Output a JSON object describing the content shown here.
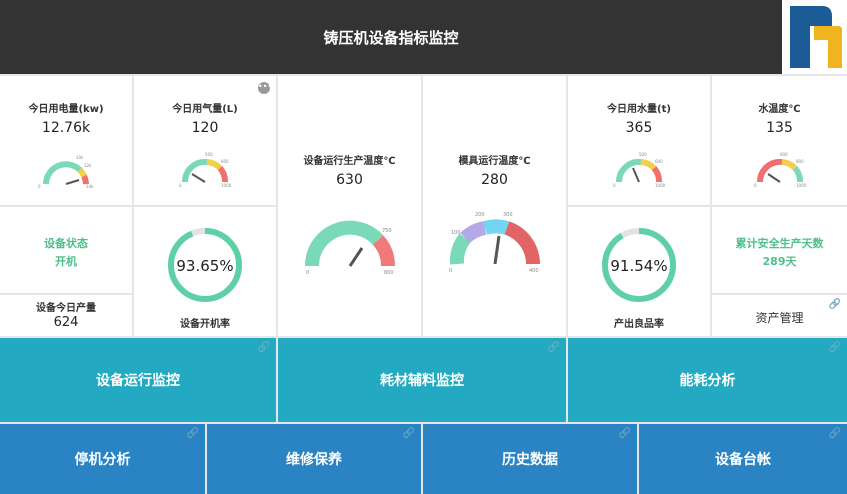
{
  "header": {
    "title": "铸压机设备指标监控"
  },
  "icons": {
    "link": "link-icon",
    "more": "more-icon",
    "logo": "company-logo"
  },
  "colors": {
    "teal": "#23aac2",
    "blue": "#2a84c3",
    "green": "#4fbf8c",
    "header": "#333333"
  },
  "cards": {
    "electricity": {
      "label": "今日用电量(kw)",
      "value": "12.76k",
      "ticks": [
        "0",
        "10k",
        "12k",
        "14k"
      ]
    },
    "gas": {
      "label": "今日用气量(L)",
      "value": "120",
      "ticks": [
        "0",
        "500",
        "600",
        "1000"
      ]
    },
    "device_temp": {
      "label": "设备运行生产温度℃",
      "value": "630",
      "ticks": [
        "0",
        "750",
        "800"
      ]
    },
    "mold_temp": {
      "label": "模具运行温度℃",
      "value": "280",
      "ticks": [
        "0",
        "100",
        "200",
        "300",
        "400"
      ]
    },
    "water": {
      "label": "今日用水量(t)",
      "value": "365",
      "ticks": [
        "0",
        "500",
        "600",
        "1000"
      ]
    },
    "water_temp": {
      "label": "水温度℃",
      "value": "135",
      "ticks": [
        "0",
        "600",
        "800",
        "1000"
      ]
    },
    "device_status": {
      "label": "设备状态",
      "value": "开机"
    },
    "daily_output": {
      "label": "设备今日产量",
      "value": "624"
    },
    "uptime": {
      "label": "设备开机率",
      "value": "93.65%",
      "fraction": 0.9365
    },
    "yield": {
      "label": "产出良品率",
      "value": "91.54%",
      "fraction": 0.9154
    },
    "safety": {
      "label": "累计安全生产天数",
      "value": "289天"
    },
    "asset": {
      "label": "资产管理"
    }
  },
  "tiles": {
    "row1": [
      "设备运行监控",
      "耗材辅料监控",
      "能耗分析"
    ],
    "row2": [
      "停机分析",
      "维修保养",
      "历史数据",
      "设备台帐"
    ]
  }
}
